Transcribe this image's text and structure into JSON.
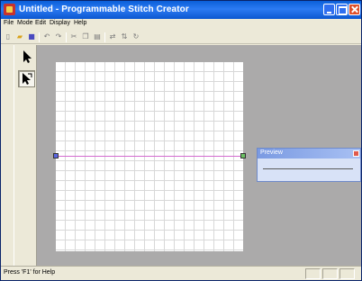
{
  "window": {
    "title": "Untitled - Programmable Stitch Creator"
  },
  "menu": {
    "items": [
      "File",
      "Mode",
      "Edit",
      "Display",
      "Help"
    ]
  },
  "toolbar": {
    "icons": [
      "new-icon",
      "open-icon",
      "save-icon",
      "undo-icon",
      "redo-icon",
      "cut-icon",
      "copy-icon",
      "paste-icon",
      "flip-horizontal-icon",
      "flip-vertical-icon",
      "rotate-icon"
    ]
  },
  "tools": {
    "select_icon": "arrow-select-icon",
    "point_icon": "point-edit-icon"
  },
  "preview": {
    "title": "Preview"
  },
  "status": {
    "text": "Press 'F1' for Help"
  },
  "colors": {
    "title_bar": "#0a5fd9",
    "stitch_line": "#d36ad0",
    "start_handle": "#5a66e0",
    "end_handle": "#6ac063"
  }
}
